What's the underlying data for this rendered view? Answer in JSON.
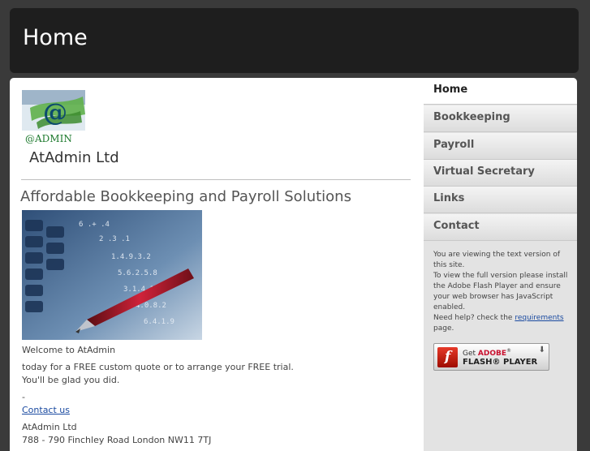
{
  "header": {
    "title": "Home"
  },
  "logo": {
    "text": "@ADMIN"
  },
  "company_name": "AtAdmin Ltd",
  "headline": "Affordable Bookkeeping and Payroll Solutions",
  "body": {
    "welcome": "Welcome to AtAdmin",
    "quote": " today for a FREE custom quote or to arrange your FREE trial.",
    "glad": "You'll be glad you did.",
    "dash": "-",
    "contact_link": "Contact us",
    "address_name": "AtAdmin Ltd",
    "address_line": "788 - 790 Finchley Road London NW11 7TJ"
  },
  "nav": {
    "items": [
      {
        "label": "Home",
        "active": true
      },
      {
        "label": "Bookkeeping"
      },
      {
        "label": "Payroll"
      },
      {
        "label": "Virtual Secretary"
      },
      {
        "label": "Links"
      },
      {
        "label": "Contact"
      }
    ]
  },
  "flash": {
    "line1": "You are viewing the text version of this site.",
    "line2": "To view the full version please install the Adobe Flash Player and ensure your web browser has JavaScript enabled.",
    "line3_prefix": "Need help? check the ",
    "requirements_link": "requirements",
    "line3_suffix": " page.",
    "badge_get": "Get ",
    "badge_adobe": "ADOBE",
    "badge_player": "FLASH® PLAYER",
    "badge_f": "f"
  },
  "colors": {
    "header_bg": "#1e1e1e",
    "link": "#1a4aa0",
    "sidebar_bg": "#e3e3e3"
  }
}
